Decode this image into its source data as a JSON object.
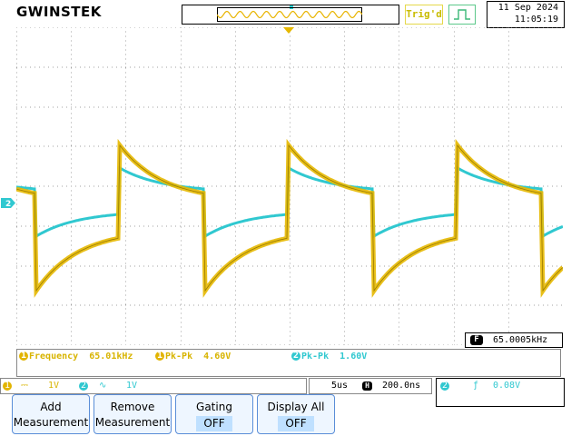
{
  "header": {
    "brand": "GWINSTEK",
    "trigger_status": "Trig'd",
    "trigger_type_icon": "edge-pulse-icon",
    "date": "11 Sep 2024",
    "time": "11:05:19"
  },
  "colors": {
    "ch1": "#e2b400",
    "ch2": "#30c8d0",
    "grid": "#a0a0a0"
  },
  "display": {
    "ch2_marker": "2",
    "counter_icon": "F",
    "counter_value": "65.0005kHz"
  },
  "measurements": [
    {
      "channel": "1",
      "label": "Frequency",
      "value": "65.01kHz"
    },
    {
      "channel": "1",
      "label": "Pk-Pk",
      "value": "4.60V"
    },
    {
      "channel": "2",
      "label": "Pk-Pk",
      "value": "1.60V"
    }
  ],
  "channels": [
    {
      "number": "1",
      "coupling_icon": "dc-coupling-icon",
      "coupling_glyph": "⎓",
      "scale": "1V"
    },
    {
      "number": "2",
      "coupling_icon": "ac-coupling-icon",
      "coupling_glyph": "∿",
      "scale": "1V"
    }
  ],
  "timebase": {
    "scale": "5us",
    "position_icon": "H",
    "position": "200.0ns"
  },
  "trigger": {
    "source": "2",
    "slope_glyph": "ƒ",
    "level": "0.08V"
  },
  "softkeys": [
    {
      "line1": "Add",
      "line2": "Measurement",
      "value": ""
    },
    {
      "line1": "Remove",
      "line2": "Measurement",
      "value": ""
    },
    {
      "line1": "Gating",
      "line2": "",
      "value": "OFF"
    },
    {
      "line1": "Display All",
      "line2": "",
      "value": "OFF"
    }
  ]
}
